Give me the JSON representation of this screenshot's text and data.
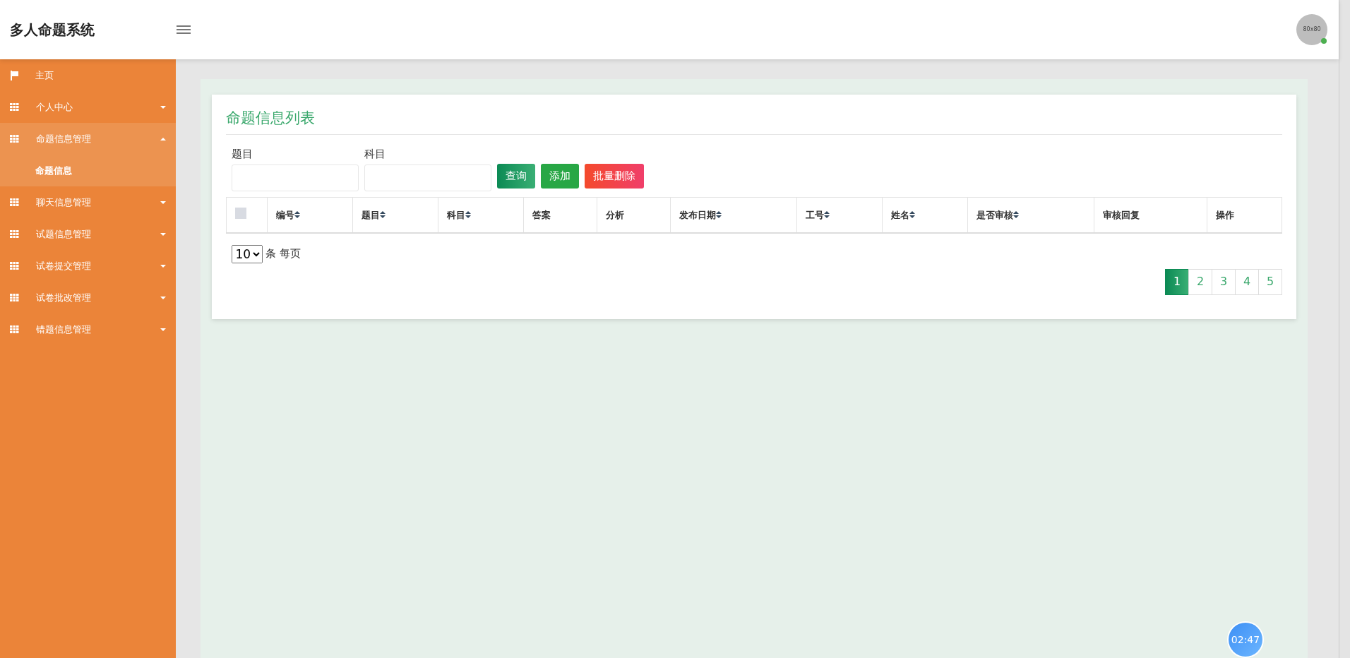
{
  "header": {
    "title": "多人命题系统",
    "avatar_text": "80x80",
    "online": true
  },
  "sidebar": {
    "items": [
      {
        "kind": "link",
        "label": "主页"
      },
      {
        "kind": "menu",
        "label": "个人中心",
        "expanded": false
      },
      {
        "kind": "menu",
        "label": "命题信息管理",
        "expanded": true,
        "children": [
          {
            "label": "命题信息"
          }
        ]
      },
      {
        "kind": "menu",
        "label": "聊天信息管理",
        "expanded": false
      },
      {
        "kind": "menu",
        "label": "试题信息管理",
        "expanded": false
      },
      {
        "kind": "menu",
        "label": "试卷提交管理",
        "expanded": false
      },
      {
        "kind": "menu",
        "label": "试卷批改管理",
        "expanded": false
      },
      {
        "kind": "menu",
        "label": "错题信息管理",
        "expanded": false
      }
    ]
  },
  "panel": {
    "title": "命题信息列表",
    "filters": [
      {
        "label": "题目"
      },
      {
        "label": "科目"
      }
    ],
    "buttons": [
      {
        "kind": "search",
        "label": "查询"
      },
      {
        "kind": "add",
        "label": "添加"
      },
      {
        "kind": "delete",
        "label": "批量删除"
      }
    ],
    "table": {
      "select_all": {
        "checked": false
      },
      "columns": [
        {
          "label": "编号",
          "sortable": true
        },
        {
          "label": "题目",
          "sortable": true
        },
        {
          "label": "科目",
          "sortable": true
        },
        {
          "label": "答案",
          "sortable": false
        },
        {
          "label": "分析",
          "sortable": false
        },
        {
          "label": "发布日期",
          "sortable": true
        },
        {
          "label": "工号",
          "sortable": true
        },
        {
          "label": "姓名",
          "sortable": true
        },
        {
          "label": "是否审核",
          "sortable": true
        },
        {
          "label": "审核回复",
          "sortable": false
        },
        {
          "label": "操作",
          "sortable": false
        }
      ]
    },
    "page_size": {
      "value": "10",
      "suffix": "条 每页"
    },
    "pages": [
      {
        "label": "1",
        "selected": true
      },
      {
        "label": "2",
        "selected": false
      },
      {
        "label": "3",
        "selected": false
      },
      {
        "label": "4",
        "selected": false
      },
      {
        "label": "5",
        "selected": false
      }
    ]
  },
  "timer": {
    "text": "02:47"
  }
}
